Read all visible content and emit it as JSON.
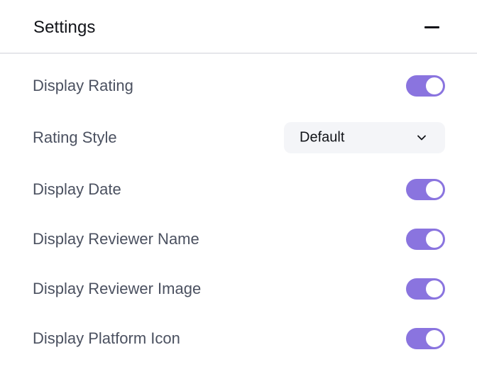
{
  "header": {
    "title": "Settings",
    "collapse_icon": "minus-icon"
  },
  "settings": {
    "display_rating": {
      "label": "Display Rating",
      "enabled": true
    },
    "rating_style": {
      "label": "Rating Style",
      "value": "Default",
      "icon": "chevron-down-icon"
    },
    "display_date": {
      "label": "Display Date",
      "enabled": true
    },
    "display_reviewer_name": {
      "label": "Display Reviewer Name",
      "enabled": true
    },
    "display_reviewer_image": {
      "label": "Display Reviewer Image",
      "enabled": true
    },
    "display_platform_icon": {
      "label": "Display Platform Icon",
      "enabled": true
    }
  },
  "colors": {
    "toggle_on": "#8a74df",
    "label_text": "#4b5160",
    "select_bg": "#f4f5f8",
    "divider": "#e6e7eb"
  }
}
